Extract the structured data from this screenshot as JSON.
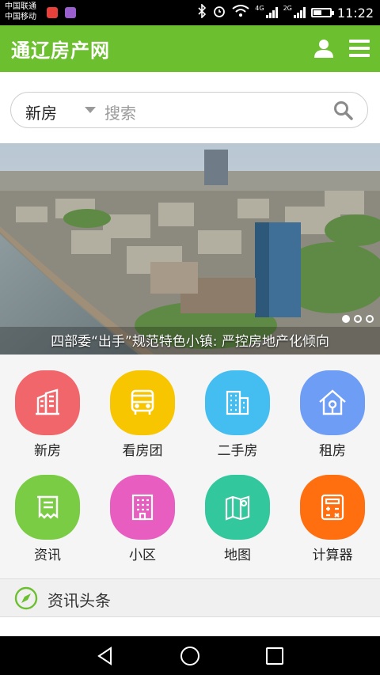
{
  "status_bar": {
    "carrier_1": "中国联通",
    "carrier_2": "中国移动",
    "net_1": "4G",
    "net_2": "2G",
    "time": "11:22",
    "battery_level": 0.5,
    "colors": {
      "app_icon_1": "#e8403b",
      "app_icon_2": "#9a5fcf"
    }
  },
  "header": {
    "title": "通辽房产网",
    "background": "#6cbf2e",
    "icons": [
      "user-icon",
      "menu-icon"
    ]
  },
  "search": {
    "type": "新房",
    "placeholder": "搜索",
    "icon": "search-icon"
  },
  "banner": {
    "caption": "四部委“出手”规范特色小镇: 严控房地产化倾向",
    "slides": 3,
    "active_slide": 1
  },
  "categories": [
    {
      "label": "新房",
      "icon": "building-icon",
      "color": "#f0666a"
    },
    {
      "label": "看房团",
      "icon": "bus-icon",
      "color": "#f7c600"
    },
    {
      "label": "二手房",
      "icon": "apartment-icon",
      "color": "#44bdf0"
    },
    {
      "label": "租房",
      "icon": "house-icon",
      "color": "#6d9df5"
    },
    {
      "label": "资讯",
      "icon": "scroll-icon",
      "color": "#7acc45"
    },
    {
      "label": "小区",
      "icon": "complex-icon",
      "color": "#e75ec0"
    },
    {
      "label": "地图",
      "icon": "map-icon",
      "color": "#32c79c"
    },
    {
      "label": "计算器",
      "icon": "calculator-icon",
      "color": "#ff6f10"
    }
  ],
  "news": {
    "title": "资讯头条",
    "icon": "compass-icon"
  },
  "navbar": {
    "icons": [
      "back-icon",
      "home-icon",
      "recents-icon"
    ]
  }
}
